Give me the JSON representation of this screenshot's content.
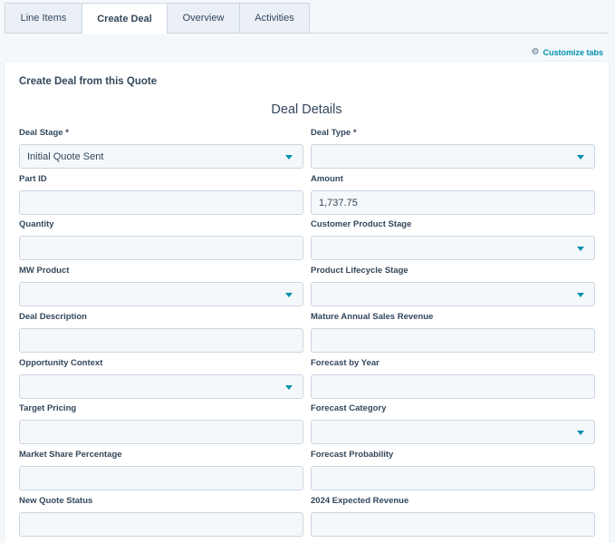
{
  "tabs": [
    {
      "label": "Line Items",
      "active": false
    },
    {
      "label": "Create Deal",
      "active": true
    },
    {
      "label": "Overview",
      "active": false
    },
    {
      "label": "Activities",
      "active": false
    }
  ],
  "customize": {
    "label": "Customize tabs",
    "icon": "gear-icon"
  },
  "card": {
    "title": "Create Deal from this Quote",
    "section_title": "Deal Details"
  },
  "fields": {
    "left": [
      {
        "label": "Deal Stage *",
        "value": "Initial Quote Sent",
        "type": "select"
      },
      {
        "label": "Part ID",
        "value": "",
        "type": "text"
      },
      {
        "label": "Quantity",
        "value": "",
        "type": "text"
      },
      {
        "label": "MW Product",
        "value": "",
        "type": "select"
      },
      {
        "label": "Deal Description",
        "value": "",
        "type": "text"
      },
      {
        "label": "Opportunity Context",
        "value": "",
        "type": "select"
      },
      {
        "label": "Target Pricing",
        "value": "",
        "type": "text"
      },
      {
        "label": "Market Share Percentage",
        "value": "",
        "type": "text"
      },
      {
        "label": "New Quote Status",
        "value": "",
        "type": "text"
      }
    ],
    "right": [
      {
        "label": "Deal Type *",
        "value": "",
        "type": "select"
      },
      {
        "label": "Amount",
        "value": "1,737.75",
        "type": "text"
      },
      {
        "label": "Customer Product Stage",
        "value": "",
        "type": "select"
      },
      {
        "label": "Product Lifecycle Stage",
        "value": "",
        "type": "select"
      },
      {
        "label": "Mature Annual Sales Revenue",
        "value": "",
        "type": "text"
      },
      {
        "label": "Forecast by Year",
        "value": "",
        "type": "text"
      },
      {
        "label": "Forecast Category",
        "value": "",
        "type": "select"
      },
      {
        "label": "Forecast Probability",
        "value": "",
        "type": "text"
      },
      {
        "label": "2024 Expected Revenue",
        "value": "",
        "type": "text"
      }
    ]
  },
  "colors": {
    "accent": "#0091ae",
    "text": "#33475b",
    "border": "#cbd6e2",
    "field_bg": "#f5f8fa"
  }
}
